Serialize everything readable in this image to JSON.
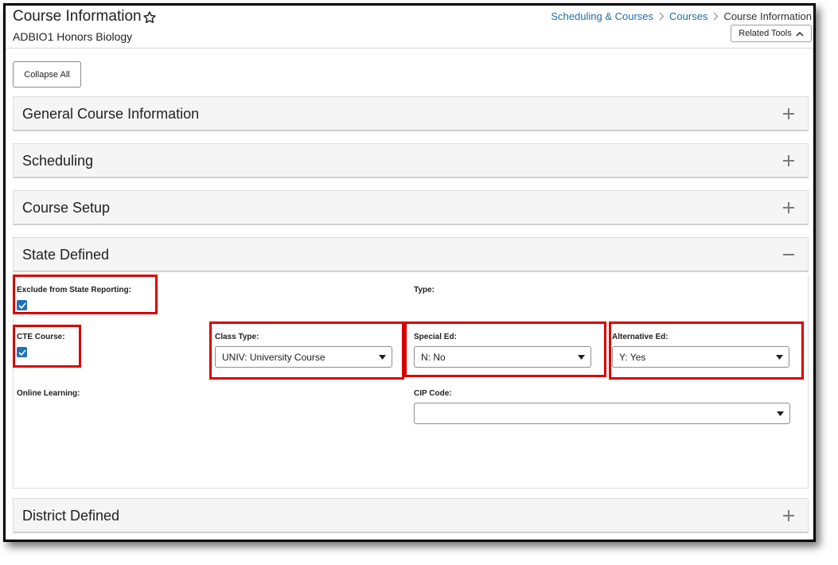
{
  "header": {
    "title": "Course Information",
    "subtitle": "ADBIO1 Honors Biology",
    "breadcrumb": [
      "Scheduling & Courses",
      "Courses",
      "Course Information"
    ],
    "related_tools_label": "Related Tools",
    "favorite_icon": "star-outline-icon"
  },
  "toolbar": {
    "collapse_all_label": "Collapse All"
  },
  "panels": [
    {
      "title": "General Course Information",
      "state": "collapsed",
      "icon": "plus-icon"
    },
    {
      "title": "Scheduling",
      "state": "collapsed",
      "icon": "plus-icon"
    },
    {
      "title": "Course Setup",
      "state": "collapsed",
      "icon": "plus-icon"
    },
    {
      "title": "State Defined",
      "state": "expanded",
      "icon": "minus-icon"
    },
    {
      "title": "District Defined",
      "state": "collapsed",
      "icon": "plus-icon"
    }
  ],
  "state_defined": {
    "exclude_label": "Exclude from State Reporting:",
    "exclude_checked": true,
    "type_label": "Type:",
    "cte_label": "CTE Course:",
    "cte_checked": true,
    "class_type_label": "Class Type:",
    "class_type_value": "UNIV: University Course",
    "special_ed_label": "Special Ed:",
    "special_ed_value": "N: No",
    "alternative_ed_label": "Alternative Ed:",
    "alternative_ed_value": "Y: Yes",
    "online_learning_label": "Online Learning:",
    "cip_code_label": "CIP Code:",
    "cip_code_value": ""
  },
  "colors": {
    "link": "#1a6fa8",
    "checkbox": "#1f72b8",
    "highlight": "#d80000",
    "panel_header_bg": "#f5f5f5"
  }
}
